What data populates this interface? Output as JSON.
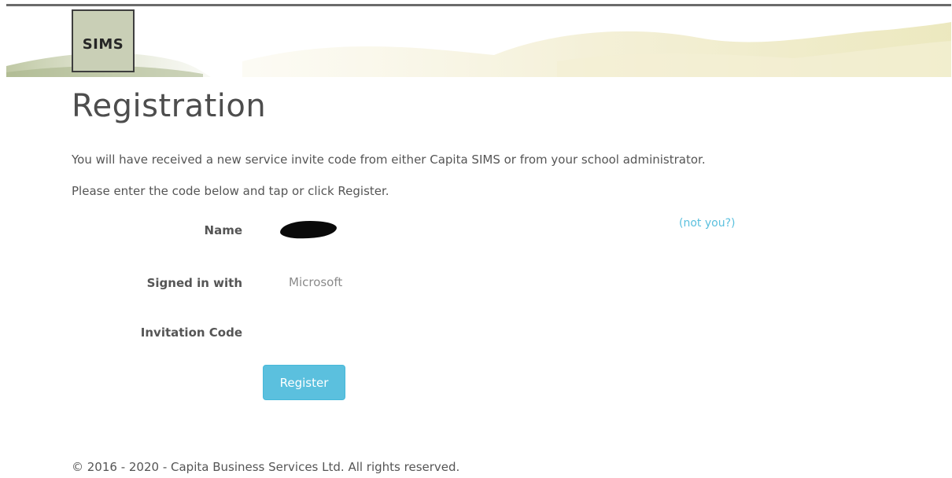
{
  "header": {
    "logo_text": "SIMS"
  },
  "page": {
    "title": "Registration",
    "intro_line_1": "You will have received a new service invite code from either Capita SIMS or from your school administrator.",
    "intro_line_2": "Please enter the code below and tap or click Register."
  },
  "form": {
    "name_label": "Name",
    "name_value": "redacted",
    "not_you_link": "(not you?)",
    "signed_in_label": "Signed in with",
    "signed_in_value": "Microsoft",
    "invitation_label": "Invitation Code",
    "invitation_value": "",
    "register_label": "Register"
  },
  "footer": {
    "copyright": "© 2016 - 2020 - Capita Business Services Ltd. All rights reserved."
  },
  "colors": {
    "accent": "#5bc0de",
    "text": "#555555",
    "logo_background": "#c9cfb6"
  }
}
